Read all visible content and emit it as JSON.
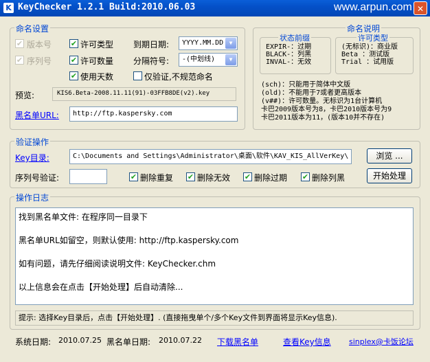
{
  "window": {
    "title": "KeyChecker 1.2.1 Build:2010.06.03",
    "watermark": "www.arpun.com"
  },
  "naming": {
    "group_label": "命名设置",
    "cb_version": "版本号",
    "cb_serial": "序列号",
    "cb_license_type": "许可类型",
    "cb_license_count": "许可数量",
    "cb_use_days": "使用天数",
    "expiry_label": "到期日期:",
    "expiry_value": "YYYY.MM.DD",
    "sep_label": "分隔符号:",
    "sep_value": "-(中划线)",
    "cb_verify_only": "仅验证,不规范命名",
    "preview_label": "预览:",
    "preview_value": "KIS6.Beta-2008.11.11(91)-03FFB8DE(v2).key",
    "blacklist_url_label": "黑名单URL:",
    "blacklist_url_value": "http://ftp.kaspersky.com"
  },
  "naming_help": {
    "group_label": "命名说明",
    "status_title": "状态前缀",
    "status_lines": [
      "EXPIR-：过期",
      "BLACK-：列黑",
      "INVAL-：无效"
    ],
    "license_title": "许可类型",
    "license_lines": [
      "(无标识)：商业版",
      "Beta  ：测试版",
      "Trial ：试用版"
    ],
    "notes": [
      "(sch)：只能用于简体中文版",
      "(old)：不能用于7或者更高版本",
      "(v##)：许可数量。无标识为1台计算机",
      "卡巴2009版本号为8，卡巴2010版本号为9",
      "卡巴2011版本为11，(版本10并不存在)"
    ]
  },
  "verify": {
    "group_label": "验证操作",
    "key_dir_label": "Key目录:",
    "key_dir_value": "C:\\Documents and Settings\\Administrator\\桌面\\软件\\KAV_KIS_AllVerKey\\",
    "browse_label": "浏览 ...",
    "serial_label": "序列号验证:",
    "serial_value": "",
    "cb_del_dup": "删除重复",
    "cb_del_invalid": "删除无效",
    "cb_del_expired": "删除过期",
    "cb_del_black": "删除列黑",
    "start_label": "开始处理"
  },
  "log": {
    "group_label": "操作日志",
    "lines": [
      "找到黑名单文件: 在程序同一目录下",
      "黑名单URL如留空，则默认使用: http://ftp.kaspersky.com",
      "如有问题，请先仔细阅读说明文件: KeyChecker.chm",
      "以上信息会在点击【开始处理】后自动清除..."
    ],
    "hint": "提示: 选择Key目录后，点击【开始处理】. (直接拖曳单个/多个Key文件到界面将显示Key信息)."
  },
  "footer": {
    "system_date_label": "系统日期:",
    "system_date_value": "2010.07.25",
    "blacklist_date_label": "黑名单日期:",
    "blacklist_date_value": "2010.07.22",
    "download_link": "下载黑名单",
    "view_link": "查看Key信息",
    "forum_link": "sinplex@卡饭论坛"
  }
}
